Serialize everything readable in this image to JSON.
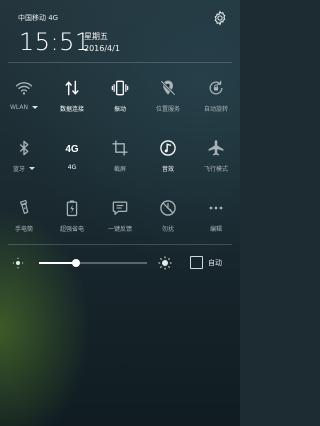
{
  "status": {
    "carrier": "中国移动 4G"
  },
  "clock": {
    "time": "15:51",
    "weekday": "星期五",
    "date": "2016/4/1"
  },
  "tiles": [
    [
      {
        "name": "wlan",
        "label": "WLAN",
        "icon": "wifi-icon",
        "state": "off",
        "dropdown": true
      },
      {
        "name": "mobile-data",
        "label": "数据连接",
        "icon": "data-arrows-icon",
        "state": "on",
        "dropdown": false
      },
      {
        "name": "vibrate",
        "label": "振动",
        "icon": "vibrate-icon",
        "state": "on",
        "dropdown": false
      },
      {
        "name": "location",
        "label": "位置服务",
        "icon": "location-off-icon",
        "state": "off",
        "dropdown": false
      },
      {
        "name": "auto-rotate",
        "label": "自动旋转",
        "icon": "rotate-lock-icon",
        "state": "off",
        "dropdown": false
      }
    ],
    [
      {
        "name": "bluetooth",
        "label": "蓝牙",
        "icon": "bluetooth-icon",
        "state": "off",
        "dropdown": true
      },
      {
        "name": "4g",
        "label": "4G",
        "icon": "4g-icon",
        "state": "on",
        "dropdown": false
      },
      {
        "name": "screenshot",
        "label": "截屏",
        "icon": "crop-icon",
        "state": "off",
        "dropdown": false
      },
      {
        "name": "music",
        "label": "音效",
        "icon": "music-icon",
        "state": "on",
        "dropdown": false
      },
      {
        "name": "airplane",
        "label": "飞行模式",
        "icon": "airplane-icon",
        "state": "off",
        "dropdown": false
      }
    ],
    [
      {
        "name": "flashlight",
        "label": "手电筒",
        "icon": "flashlight-icon",
        "state": "off",
        "dropdown": false
      },
      {
        "name": "power-saver",
        "label": "超强省电",
        "icon": "battery-icon",
        "state": "off",
        "dropdown": false
      },
      {
        "name": "feedback",
        "label": "一键反馈",
        "icon": "feedback-icon",
        "state": "off",
        "dropdown": false
      },
      {
        "name": "dnd",
        "label": "勿扰",
        "icon": "dnd-icon",
        "state": "off",
        "dropdown": false
      },
      {
        "name": "edit",
        "label": "编辑",
        "icon": "more-dots-icon",
        "state": "off",
        "dropdown": false
      }
    ]
  ],
  "brightness": {
    "level": 0.34,
    "auto_label": "自动",
    "auto_checked": false
  }
}
